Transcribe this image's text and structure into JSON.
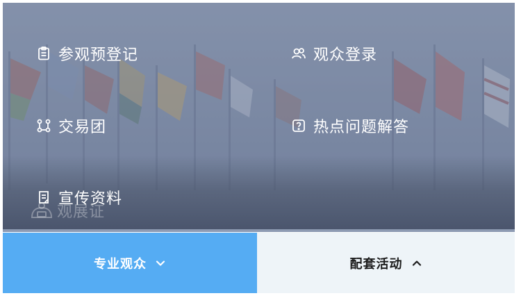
{
  "menu": {
    "items": [
      {
        "label": "参观预登记",
        "icon": "clipboard-icon"
      },
      {
        "label": "观众登录",
        "icon": "users-icon"
      },
      {
        "label": "交易团",
        "icon": "group-network-icon"
      },
      {
        "label": "热点问题解答",
        "icon": "question-icon"
      },
      {
        "label": "宣传资料",
        "icon": "document-icon"
      }
    ]
  },
  "watermark": {
    "text": "观展证"
  },
  "tabs": {
    "items": [
      {
        "label": "专业观众",
        "chevron": "chevron-down-icon",
        "active": true
      },
      {
        "label": "配套活动",
        "chevron": "chevron-up-icon",
        "active": false
      }
    ]
  },
  "colors": {
    "active_tab": "#55acf3",
    "inactive_tab": "#eef4f8",
    "hero_overlay": "#7e8ba3"
  }
}
